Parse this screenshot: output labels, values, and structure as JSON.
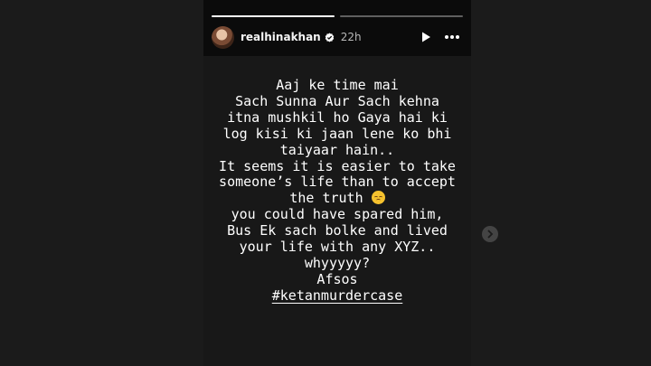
{
  "story": {
    "progress": [
      1.0,
      0.0
    ],
    "user": {
      "username": "realhinakhan",
      "verified": true,
      "time_ago": "22h"
    },
    "controls": {
      "play_icon": "play-icon",
      "more_icon": "more-options-icon"
    },
    "text_lines": [
      "Aaj ke time mai",
      "Sach Sunna Aur Sach kehna",
      "itna mushkil ho Gaya hai ki",
      "log kisi ki jaan lene ko bhi",
      "taiyaar hain..",
      "It seems it is easier to take",
      "someone’s life than to accept",
      "the truth",
      "you could have spared him,",
      "Bus Ek sach bolke and lived",
      "your life with any XYZ..",
      "whyyyyy?",
      "Afsos"
    ],
    "emoji_name": "disappointed-face-emoji",
    "hashtag": "#ketanmurdercase",
    "next_icon": "chevron-right-icon"
  },
  "colors": {
    "background": "#1b1b1b",
    "story_bg": "#181818",
    "text": "#ffffff"
  }
}
